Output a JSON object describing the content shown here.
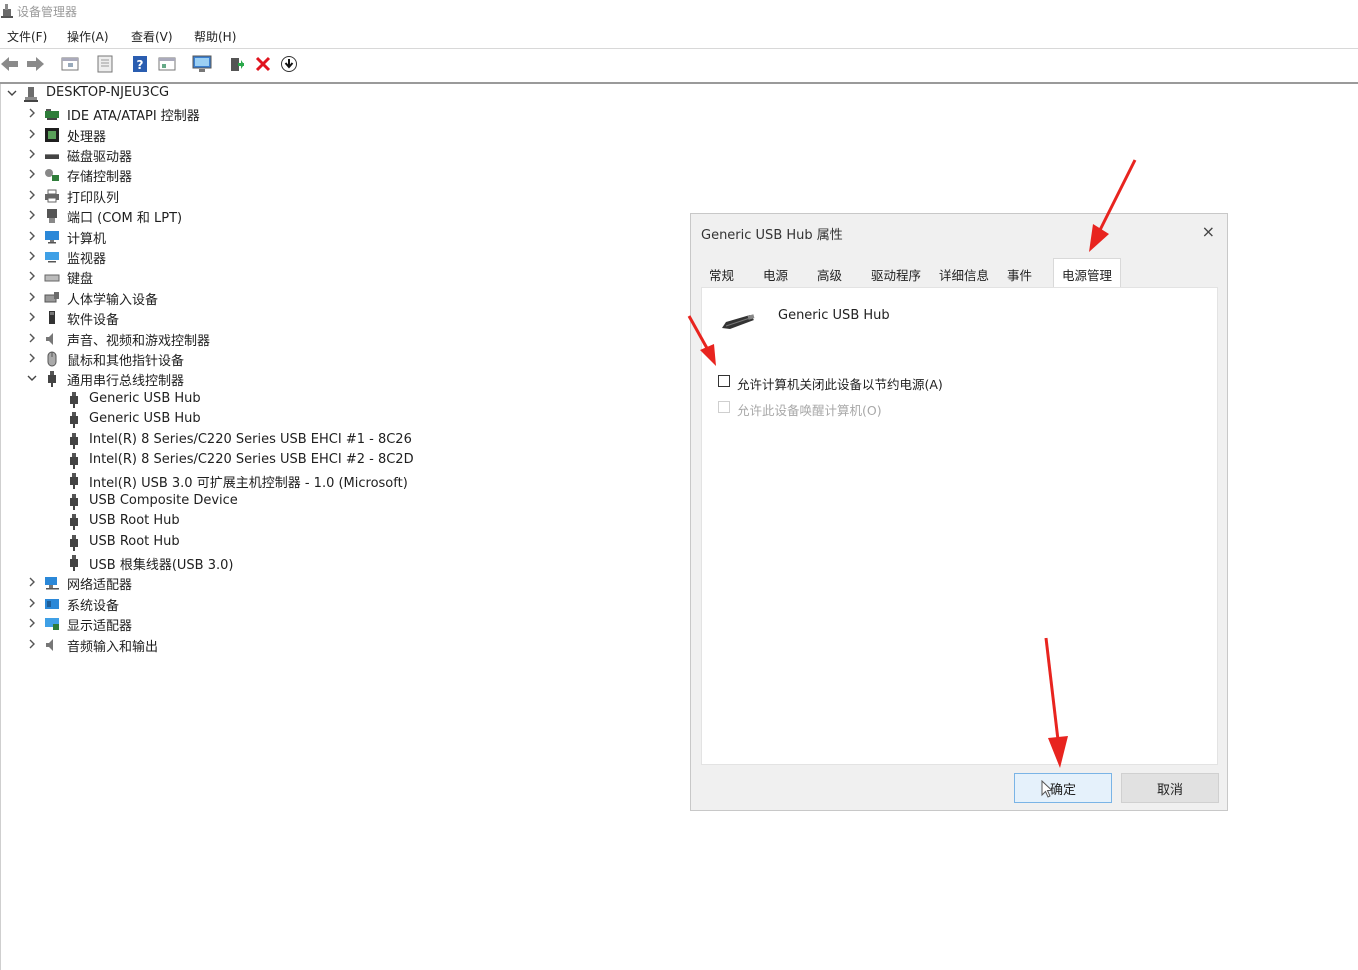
{
  "window": {
    "title": "设备管理器"
  },
  "menu": [
    {
      "label": "文件(F)"
    },
    {
      "label": "操作(A)"
    },
    {
      "label": "查看(V)"
    },
    {
      "label": "帮助(H)"
    }
  ],
  "tree": {
    "root": "DESKTOP-NJEU3CG",
    "categories": [
      {
        "label": "IDE ATA/ATAPI 控制器"
      },
      {
        "label": "处理器"
      },
      {
        "label": "磁盘驱动器"
      },
      {
        "label": "存储控制器"
      },
      {
        "label": "打印队列"
      },
      {
        "label": "端口 (COM 和 LPT)"
      },
      {
        "label": "计算机"
      },
      {
        "label": "监视器"
      },
      {
        "label": "键盘"
      },
      {
        "label": "人体学输入设备"
      },
      {
        "label": "软件设备"
      },
      {
        "label": "声音、视频和游戏控制器"
      },
      {
        "label": "鼠标和其他指针设备"
      },
      {
        "label": "通用串行总线控制器"
      }
    ],
    "usb_children": [
      {
        "label": "Generic USB Hub"
      },
      {
        "label": "Generic USB Hub"
      },
      {
        "label": "Intel(R) 8 Series/C220 Series USB EHCI #1 - 8C26"
      },
      {
        "label": "Intel(R) 8 Series/C220 Series USB EHCI #2 - 8C2D"
      },
      {
        "label": "Intel(R) USB 3.0 可扩展主机控制器 - 1.0 (Microsoft)"
      },
      {
        "label": "USB Composite Device"
      },
      {
        "label": "USB Root Hub"
      },
      {
        "label": "USB Root Hub"
      },
      {
        "label": "USB 根集线器(USB 3.0)"
      }
    ],
    "more_categories": [
      {
        "label": "网络适配器"
      },
      {
        "label": "系统设备"
      },
      {
        "label": "显示适配器"
      },
      {
        "label": "音频输入和输出"
      }
    ]
  },
  "dialog": {
    "title": "Generic USB Hub 属性",
    "close": "×",
    "tabs": [
      {
        "label": "常规"
      },
      {
        "label": "电源"
      },
      {
        "label": "高级"
      },
      {
        "label": "驱动程序"
      },
      {
        "label": "详细信息"
      },
      {
        "label": "事件"
      },
      {
        "label": "电源管理"
      }
    ],
    "active_tab": "电源管理",
    "device_name": "Generic USB Hub",
    "checkbox_allow_off": "允许计算机关闭此设备以节约电源(A)",
    "checkbox_allow_wake": "允许此设备唤醒计算机(O)",
    "ok_label": "确定",
    "cancel_label": "取消"
  },
  "colors": {
    "arrow": "#e8241f",
    "accent": "#7ab4e6"
  }
}
